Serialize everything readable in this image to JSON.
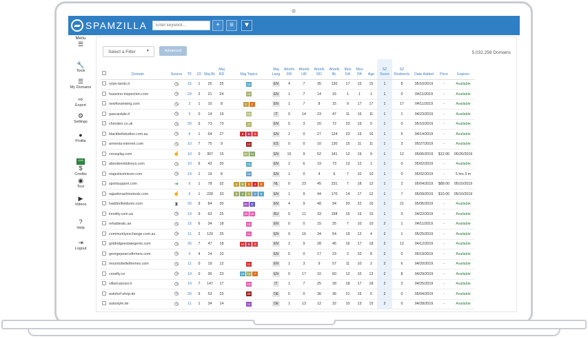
{
  "brand": {
    "name": "SPAMZILLA"
  },
  "search": {
    "placeholder": "Enter keyword..."
  },
  "toolbar": {
    "add_label": "+",
    "list_label": "≡",
    "filter_label": "▼"
  },
  "sidebar": {
    "items": [
      {
        "label": "Menu",
        "icon": "hamburger-icon",
        "glyph": "☰"
      },
      {
        "label": "Tools",
        "icon": "wrench-icon",
        "glyph": "🔧"
      },
      {
        "label": "My Domains",
        "icon": "list-icon",
        "glyph": "☰"
      },
      {
        "label": "Export",
        "icon": "export-icon",
        "glyph": "⇨"
      },
      {
        "label": "Settings",
        "icon": "gears-icon",
        "glyph": "⚙"
      },
      {
        "label": "Profile",
        "icon": "user-icon",
        "glyph": "●"
      },
      {
        "label": "Credits",
        "icon": "money-icon",
        "glyph": "$",
        "badge": "1249"
      },
      {
        "label": "Tour",
        "icon": "compass-icon",
        "glyph": "◉"
      },
      {
        "label": "Videos",
        "icon": "play-icon",
        "glyph": "▶"
      },
      {
        "label": "Help",
        "icon": "question-icon",
        "glyph": "?"
      },
      {
        "label": "Logout",
        "icon": "logout-icon",
        "glyph": "⇥"
      }
    ]
  },
  "filters": {
    "select_value": "Select a Filter",
    "advanced_label": "Advanced",
    "domain_count": "5,032,258 Domains"
  },
  "table": {
    "headers": [
      "Domain",
      "Source",
      "TF",
      "CF",
      "Maj BL",
      "Maj RD",
      "Maj Topics",
      "Maj Lang",
      "Ahrefs DR",
      "Ahrefs UR",
      "Ahrefs RD",
      "Ahrefs BL",
      "Moz DA",
      "Moz PA",
      "Age",
      "SZ Score",
      "SZ Redirects",
      "Date Added",
      "Price",
      "Expires"
    ],
    "rows": [
      {
        "domain": "rylan-lands.it",
        "src": "clock",
        "tf": "15",
        "cf": "1",
        "bl": "25",
        "rd": "25",
        "topics": [
          [
            "15",
            "#5aa8c8"
          ]
        ],
        "lang": "EN",
        "dr": "4",
        "ur": "7",
        "ard": "35",
        "abl": "130",
        "da": "17",
        "pa": "15",
        "age": "15",
        "sz": "1",
        "red": "8",
        "date": "05/10/2019",
        "price": "-",
        "exp": "Available"
      },
      {
        "domain": "hussonn-inspection.com",
        "src": "clock",
        "tf": "29",
        "cf": "2",
        "bl": "21",
        "rd": "24",
        "topics": [
          [
            "19",
            "#a4b070"
          ]
        ],
        "lang": "EN",
        "dr": "1",
        "ur": "7",
        "ard": "14",
        "abl": "16",
        "da": "1",
        "pa": "1",
        "age": "1",
        "sz": "1",
        "red": "0",
        "date": "04/11/2019",
        "price": "-",
        "exp": "Available"
      },
      {
        "domain": "newfoxsewing.com",
        "src": "clock",
        "tf": "3",
        "cf": "1",
        "bl": "10",
        "rd": "8",
        "topics": [
          [
            "3",
            "#c0a040"
          ],
          [
            "2",
            "#e07020"
          ]
        ],
        "lang": "EN",
        "dr": "1",
        "ur": "7",
        "ard": "8",
        "abl": "15",
        "da": "9",
        "pa": "17",
        "age": "17",
        "sz": "1",
        "red": "17",
        "date": "04/11/2019",
        "price": "-",
        "exp": "Available"
      },
      {
        "domain": "gascardale.it",
        "src": "clock",
        "tf": "5",
        "cf": "0",
        "bl": "14",
        "rd": "19",
        "topics": [
          [
            "19",
            "#b8c08a"
          ]
        ],
        "lang": "IT",
        "dr": "0",
        "ur": "14",
        "ard": "23",
        "abl": "47",
        "da": "11",
        "pa": "16",
        "age": "11",
        "sz": "1",
        "red": "1",
        "date": "04/23/2019",
        "price": "-",
        "exp": "Available"
      },
      {
        "domain": "chenden.co.uk",
        "src": "clock",
        "tf": "20",
        "cf": "6",
        "bl": "73",
        "rd": "73",
        "topics": [
          [
            "20",
            "#b0b060"
          ]
        ],
        "lang": "EN",
        "dr": "0",
        "ur": "3",
        "ard": "20",
        "abl": "72",
        "da": "23",
        "pa": "19",
        "age": "0",
        "sz": "1",
        "red": "0",
        "date": "05/10/2019",
        "price": "-",
        "exp": "Available"
      },
      {
        "domain": "blackbeltstudios.com.au",
        "src": "clock",
        "tf": "6",
        "cf": "1",
        "bl": "64",
        "rd": "27",
        "topics": [
          [
            "6",
            "#d03030"
          ],
          [
            "5",
            "#c04060"
          ],
          [
            "3",
            "#e04040"
          ]
        ],
        "lang": "EN",
        "dr": "2",
        "ur": "0",
        "ard": "27",
        "abl": "124",
        "da": "23",
        "pa": "19",
        "age": "16",
        "sz": "1",
        "red": "5",
        "date": "04/14/2019",
        "price": "-",
        "exp": "Available"
      },
      {
        "domain": "armenia-internet.com",
        "src": "clock",
        "tf": "10",
        "cf": "7",
        "bl": "75",
        "rd": "9",
        "topics": [
          [
            "10",
            "#9a2020"
          ]
        ],
        "lang": "ES",
        "dr": "0",
        "ur": "0",
        "ard": "10",
        "abl": "130",
        "da": "15",
        "pa": "11",
        "age": "11",
        "sz": "1",
        "red": "3",
        "date": "05/27/2019",
        "price": "-",
        "exp": "Available"
      },
      {
        "domain": "crossplay.com",
        "src": "hand",
        "tf": "10",
        "cf": "0",
        "bl": "307",
        "rd": "15",
        "topics": [
          [
            "10",
            "#a4b870"
          ],
          [
            "14",
            "#8aa870"
          ]
        ],
        "lang": "EN",
        "dr": "15",
        "ur": "9",
        "ard": "52",
        "abl": "141",
        "da": "12",
        "pa": "19",
        "age": "9",
        "sz": "1",
        "red": "12",
        "date": "05/06/2019",
        "price": "$12.00",
        "exp": "05/26/2019"
      },
      {
        "domain": "aberdeenkidneys.com",
        "src": "clock",
        "tf": "10",
        "cf": "6",
        "bl": "43",
        "rd": "20",
        "topics": [
          [
            "19",
            "#5aa8c8"
          ]
        ],
        "lang": "EN",
        "dr": "2",
        "ur": "6",
        "ard": "19",
        "abl": "73",
        "da": "13",
        "pa": "12",
        "age": "1",
        "sz": "1",
        "red": "0",
        "date": "05/02/2019",
        "price": "-",
        "exp": "Available"
      },
      {
        "domain": "majesticetriever.com",
        "src": "clock",
        "tf": "19",
        "cf": "1",
        "bl": "19",
        "rd": "8",
        "topics": [
          [
            "16",
            "#6aa0c8"
          ]
        ],
        "lang": "EN",
        "dr": "1",
        "ur": "0",
        "ard": "4",
        "abl": "6",
        "da": "7",
        "pa": "10",
        "age": "10",
        "sz": "1",
        "red": "0",
        "date": "05/02/2019",
        "price": "-",
        "exp": "5 hrs 3 m"
      },
      {
        "domain": "sportsupport.com",
        "src": "arrow",
        "tf": "6",
        "cf": "1",
        "bl": "78",
        "rd": "32",
        "topics": [
          [
            "6",
            "#c0a040"
          ],
          [
            "5",
            "#b0b060"
          ],
          [
            "5",
            "#e07020"
          ],
          [
            "4",
            "#d03030"
          ],
          [
            "6",
            "#e07020"
          ]
        ],
        "lang": "NL",
        "dr": "0",
        "ur": "23",
        "ard": "45",
        "abl": "231",
        "da": "7",
        "pa": "18",
        "age": "12",
        "sz": "1",
        "red": "2",
        "date": "05/04/2019",
        "price": "$89.00",
        "exp": "05/10/2019"
      },
      {
        "domain": "rajashmachinetools.com",
        "src": "hand",
        "tf": "6",
        "cf": "1",
        "bl": "228",
        "rd": "33",
        "topics": [
          [
            "6",
            "#a4b070"
          ],
          [
            "4",
            "#8aa870"
          ],
          [
            "3",
            "#b0b060"
          ],
          [
            "2",
            "#6aa0c8"
          ],
          [
            "5",
            "#5aa8c8"
          ]
        ],
        "lang": "EN",
        "dr": "1",
        "ur": "9",
        "ard": "44",
        "abl": "170",
        "da": "14",
        "pa": "17",
        "age": "12",
        "sz": "1",
        "red": "7",
        "date": "05/09/2019",
        "price": "$10.00",
        "exp": "05/10/2019"
      },
      {
        "domain": "haddonfieldunio.com",
        "src": "hourglass",
        "tf": "20",
        "cf": "9",
        "bl": "84",
        "rd": "20",
        "topics": [
          [
            "20",
            "#9a50c0"
          ],
          [
            "9",
            "#6a60c8"
          ]
        ],
        "lang": "EN",
        "dr": "4",
        "ur": "9",
        "ard": "48",
        "abl": "94",
        "da": "20",
        "pa": "22",
        "age": "16",
        "sz": "1",
        "red": "21",
        "date": "05/06/2019",
        "price": "-",
        "exp": "Available"
      },
      {
        "domain": "innolity.com.ua",
        "src": "clock",
        "tf": "19",
        "cf": "9",
        "bl": "63",
        "rd": "25",
        "topics": [
          [
            "19",
            "#e060b0"
          ],
          [
            "10",
            "#e060b0"
          ]
        ],
        "lang": "RU",
        "dr": "0",
        "ur": "11",
        "ard": "33",
        "abl": "158",
        "da": "15",
        "pa": "19",
        "age": "15",
        "sz": "1",
        "red": "3",
        "date": "04/22/2019",
        "price": "-",
        "exp": "Available"
      },
      {
        "domain": "rehabteatc.ae",
        "src": "clock",
        "tf": "15",
        "cf": "6",
        "bl": "34",
        "rd": "18",
        "topics": [
          [
            "15",
            "#e060b0"
          ]
        ],
        "lang": "EN",
        "dr": "0",
        "ur": "0",
        "ard": "15",
        "abl": "25",
        "da": "7",
        "pa": "10",
        "age": "10",
        "sz": "2",
        "red": "1",
        "date": "04/11/2019",
        "price": "-",
        "exp": "Available"
      },
      {
        "domain": "communityexchange.com.au",
        "src": "clock",
        "tf": "11",
        "cf": "2",
        "bl": "129",
        "rd": "25",
        "topics": [
          [
            "11",
            "#e060b0"
          ]
        ],
        "lang": "EN",
        "dr": "0",
        "ur": "16",
        "ard": "34",
        "abl": "54",
        "da": "19",
        "pa": "12",
        "age": "4",
        "sz": "2",
        "red": "1",
        "date": "05/25/2019",
        "price": "-",
        "exp": "Available"
      },
      {
        "domain": "goldridgeestategents.com",
        "src": "clock",
        "tf": "26",
        "cf": "7",
        "bl": "47",
        "rd": "18",
        "topics": [
          [
            "10",
            "#d03030"
          ],
          [
            "5",
            "#c04060"
          ],
          [
            "3",
            "#e04040"
          ]
        ],
        "lang": "EN",
        "dr": "2",
        "ur": "9",
        "ard": "28",
        "abl": "45",
        "da": "16",
        "pa": "17",
        "age": "18",
        "sz": "2",
        "red": "12",
        "date": "04/12/2019",
        "price": "-",
        "exp": "Available"
      },
      {
        "domain": "georgepearcefirmers.com",
        "src": "clock",
        "tf": "0",
        "cf": "4",
        "bl": "14",
        "rd": "10",
        "topics": [],
        "lang": "EN",
        "dr": "0",
        "ur": "0",
        "ard": "17",
        "abl": "23",
        "da": "2",
        "pa": "10",
        "age": "8",
        "sz": "2",
        "red": "0",
        "date": "05/19/2019",
        "price": "-",
        "exp": "Available"
      },
      {
        "domain": "mountobellethemes.com",
        "src": "clock",
        "tf": "11",
        "cf": "0",
        "bl": "19",
        "rd": "12",
        "topics": [
          [
            "11",
            "#d03030"
          ]
        ],
        "lang": "EN",
        "dr": "1",
        "ur": "3",
        "ard": "9",
        "abl": "57",
        "da": "11",
        "pa": "10",
        "age": "2",
        "sz": "2",
        "red": "6",
        "date": "04/20/2019",
        "price": "-",
        "exp": "Available"
      },
      {
        "domain": "crowfty.co",
        "src": "clock",
        "tf": "19",
        "cf": "0",
        "bl": "36",
        "rd": "23",
        "topics": [
          [
            "19",
            "#5aa8c8"
          ],
          [
            "12",
            "#a4b070"
          ],
          [
            "7",
            "#e07020"
          ]
        ],
        "lang": "EN",
        "dr": "0",
        "ur": "17",
        "ard": "10",
        "abl": "60",
        "da": "12",
        "pa": "10",
        "age": "13",
        "sz": "2",
        "red": "8",
        "date": "04/29/2019",
        "price": "-",
        "exp": "Available"
      },
      {
        "domain": "villaricarossi.it",
        "src": "clock",
        "tf": "19",
        "cf": "7",
        "bl": "147",
        "rd": "17",
        "topics": [
          [
            "19",
            "#e060b0"
          ]
        ],
        "lang": "IT",
        "dr": "1",
        "ur": "7",
        "ard": "25",
        "abl": "39",
        "da": "18",
        "pa": "17",
        "age": "18",
        "sz": "2",
        "red": "3",
        "date": "04/25/2019",
        "price": "-",
        "exp": "Available"
      },
      {
        "domain": "autohof-shop.de",
        "src": "clock",
        "tf": "20",
        "cf": "5",
        "bl": "53",
        "rd": "23",
        "topics": [
          [
            "20",
            "#9a2020"
          ]
        ],
        "lang": "DE",
        "dr": "0",
        "ur": "0",
        "ard": "36",
        "abl": "36",
        "da": "21",
        "pa": "15",
        "age": "0",
        "sz": "2",
        "red": "0",
        "date": "05/04/2019",
        "price": "-",
        "exp": "Available"
      },
      {
        "domain": "autostyle.de",
        "src": "clock",
        "tf": "11",
        "cf": "1",
        "bl": "34",
        "rd": "14",
        "topics": [
          [
            "11",
            "#9a50c0"
          ]
        ],
        "lang": "DE",
        "dr": "1",
        "ur": "13",
        "ard": "12",
        "abl": "32",
        "da": "10",
        "pa": "13",
        "age": "15",
        "sz": "2",
        "red": "0",
        "date": "04/28/2019",
        "price": "-",
        "exp": "Available"
      }
    ]
  },
  "colors": {
    "brand": "#2f7fc4",
    "link": "#3b7cc0",
    "available": "#2a7a3a"
  }
}
